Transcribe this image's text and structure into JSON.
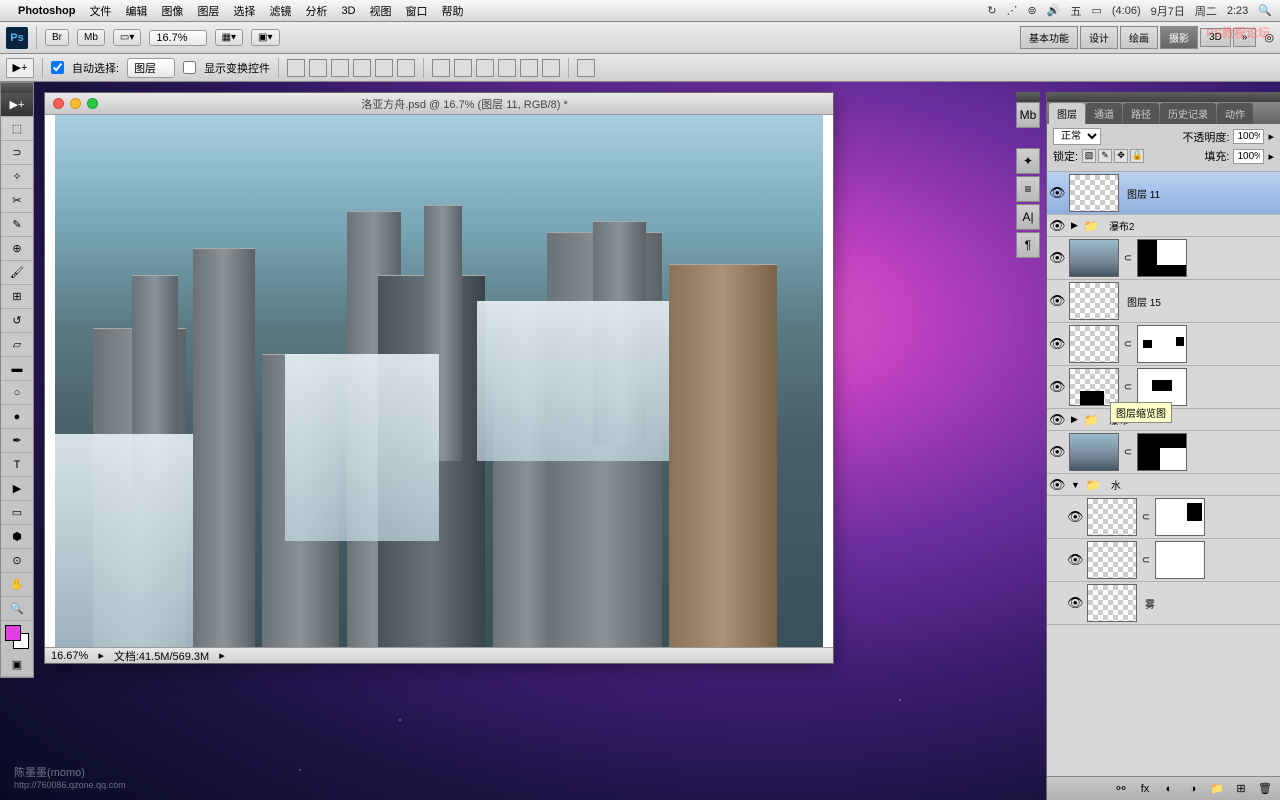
{
  "menubar": {
    "app": "Photoshop",
    "items": [
      "文件",
      "编辑",
      "图像",
      "图层",
      "选择",
      "滤镜",
      "分析",
      "3D",
      "视图",
      "窗口",
      "帮助"
    ],
    "right": {
      "battery": "(4:06)",
      "date": "9月7日",
      "day": "周二",
      "time": "2:23"
    }
  },
  "toolbar": {
    "zoom": "16.7%",
    "workspaces": [
      "基本功能",
      "设计",
      "绘画",
      "摄影",
      "3D"
    ],
    "active_workspace": "摄影",
    "br_label": "Br",
    "mb_label": "Mb"
  },
  "options": {
    "auto_select": "自动选择:",
    "layer_dropdown": "图层",
    "show_transform": "显示变换控件"
  },
  "document": {
    "title": "洛亚方舟.psd @ 16.7% (图层 11, RGB/8) *",
    "zoom": "16.67%",
    "filesize": "文档:41.5M/569.3M"
  },
  "panel": {
    "tabs": [
      "图层",
      "通道",
      "路径",
      "历史记录",
      "动作"
    ],
    "blend_mode": "正常",
    "opacity_label": "不透明度:",
    "opacity": "100%",
    "lock_label": "锁定:",
    "fill_label": "填充:",
    "fill": "100%"
  },
  "layers": [
    {
      "name": "图层 11",
      "type": "layer",
      "selected": true
    },
    {
      "name": "瀑布2",
      "type": "group"
    },
    {
      "name": "",
      "type": "layer-mask"
    },
    {
      "name": "图层 15",
      "type": "layer"
    },
    {
      "name": "",
      "type": "layer-mask"
    },
    {
      "name": "",
      "type": "layer-mask"
    },
    {
      "name": "瀑布",
      "type": "group"
    },
    {
      "name": "",
      "type": "layer-mask"
    },
    {
      "name": "水",
      "type": "group-open"
    },
    {
      "name": "",
      "type": "layer-mask",
      "indent": true
    },
    {
      "name": "",
      "type": "layer-mask",
      "indent": true
    },
    {
      "name": "雾",
      "type": "layer",
      "indent": true
    }
  ],
  "tooltip": "图层缩览图",
  "watermark": {
    "name": "陈墨墨(momo)",
    "url": "http://760086.qzone.qq.com"
  },
  "br_watermark": "PS教程论坛"
}
